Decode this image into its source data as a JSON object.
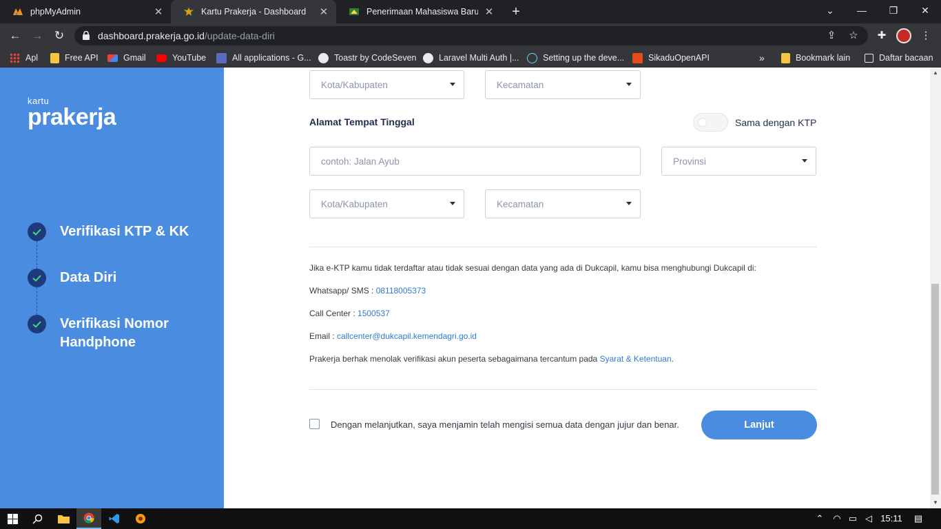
{
  "browser": {
    "tabs": [
      {
        "title": "phpMyAdmin",
        "favicon": "phpmyadmin-icon",
        "active": false
      },
      {
        "title": "Kartu Prakerja - Dashboard",
        "favicon": "garuda-icon",
        "active": true
      },
      {
        "title": "Penerimaan Mahasiswa Baru",
        "favicon": "university-icon",
        "active": false
      }
    ],
    "url_host": "dashboard.prakerja.go.id",
    "url_path": "/update-data-diri",
    "bookmarks": [
      {
        "label": "Apl",
        "icon": "apps-grid-icon"
      },
      {
        "label": "Free API",
        "icon": "folder-icon"
      },
      {
        "label": "Gmail",
        "icon": "gmail-icon"
      },
      {
        "label": "YouTube",
        "icon": "youtube-icon"
      },
      {
        "label": "All applications - G...",
        "icon": "app-icon"
      },
      {
        "label": "Toastr by CodeSeven",
        "icon": "globe-icon"
      },
      {
        "label": "Laravel Multi Auth |...",
        "icon": "globe-icon"
      },
      {
        "label": "Setting up the deve...",
        "icon": "react-icon"
      },
      {
        "label": "SikaduOpenAPI",
        "icon": "api-icon"
      }
    ],
    "bookmarks_other": "Bookmark lain",
    "reading_list": "Daftar bacaan"
  },
  "sidebar": {
    "logo_small": "kartu",
    "logo_big": "prakerja",
    "steps": [
      {
        "label": "Verifikasi KTP & KK",
        "done": true
      },
      {
        "label": "Data Diri",
        "done": true
      },
      {
        "label": "Verifikasi Nomor Handphone",
        "done": true
      }
    ]
  },
  "form": {
    "ktp_city_placeholder": "Kota/Kabupaten",
    "ktp_district_placeholder": "Kecamatan",
    "residence_title": "Alamat Tempat Tinggal",
    "same_as_ktp_label": "Sama dengan KTP",
    "same_as_ktp_on": false,
    "address_placeholder": "contoh: Jalan Ayub",
    "province_placeholder": "Provinsi",
    "city_placeholder": "Kota/Kabupaten",
    "district_placeholder": "Kecamatan"
  },
  "info": {
    "intro": "Jika e-KTP kamu tidak terdaftar atau tidak sesuai dengan data yang ada di Dukcapil, kamu bisa menghubungi Dukcapil di:",
    "whatsapp_label": "Whatsapp/ SMS : ",
    "whatsapp_value": "08118005373",
    "call_label": "Call Center : ",
    "call_value": "1500537",
    "email_label": "Email : ",
    "email_value": "callcenter@dukcapil.kemendagri.go.id",
    "terms_text": "Prakerja berhak menolak verifikasi akun peserta sebagaimana tercantum pada ",
    "terms_link": "Syarat & Ketentuan",
    "terms_end": "."
  },
  "agreement": {
    "checked": false,
    "text": "Dengan melanjutkan, saya menjamin telah mengisi semua data dengan jujur dan benar."
  },
  "submit_label": "Lanjut",
  "taskbar": {
    "time": "15:11"
  },
  "colors": {
    "sidebar": "#4a8de0",
    "primary": "#4a8de0",
    "step_dot": "#1f3a7a",
    "link": "#2f7ad1"
  }
}
